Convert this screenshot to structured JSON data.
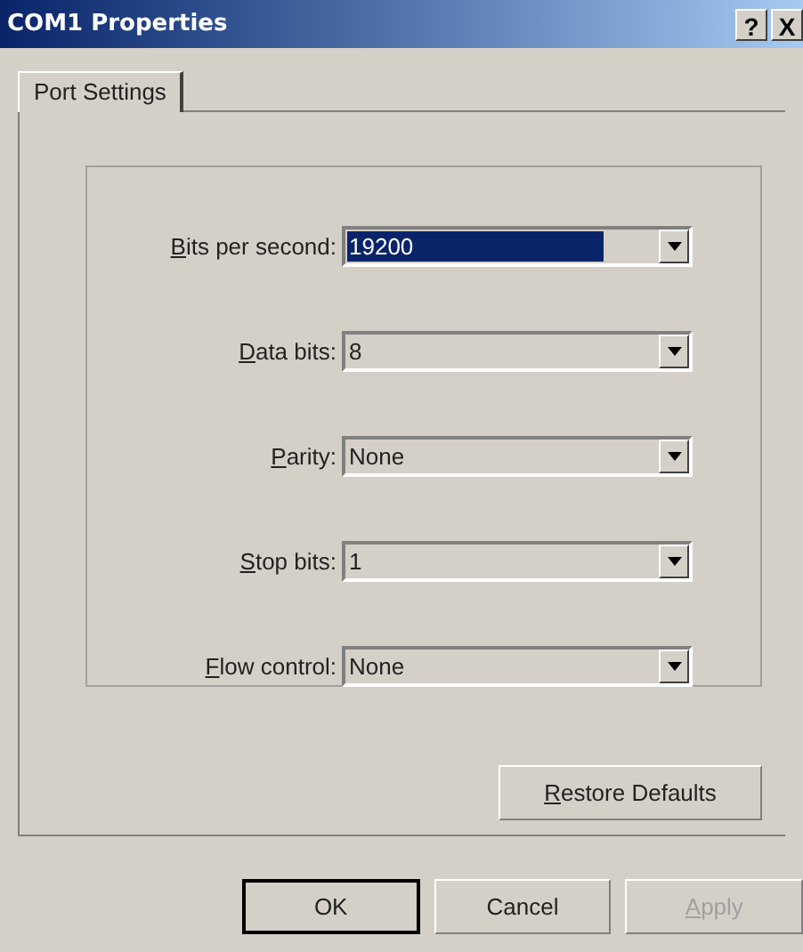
{
  "window": {
    "title": "COM1 Properties",
    "controls": [
      "?",
      "X"
    ]
  },
  "tabs": [
    {
      "label": "Port Settings",
      "selected": true
    }
  ],
  "fields": [
    {
      "label": "Bits per second:",
      "value": "19200",
      "focused": true,
      "underline_first": true
    },
    {
      "label": "Data bits:",
      "value": "8",
      "focused": false,
      "underline_first": true
    },
    {
      "label": "Parity:",
      "value": "None",
      "focused": false,
      "underline_first": true
    },
    {
      "label": "Stop bits:",
      "value": "1",
      "focused": false,
      "underline_first": true
    },
    {
      "label": "Flow control:",
      "value": "None",
      "focused": false,
      "underline_first": true
    }
  ],
  "restore_button": {
    "label": "Restore Defaults",
    "underline_first": true
  },
  "buttons": [
    {
      "label": "OK",
      "default": true,
      "disabled": false,
      "underline_first": false
    },
    {
      "label": "Cancel",
      "default": false,
      "disabled": false,
      "underline_first": false
    },
    {
      "label": "Apply",
      "default": false,
      "disabled": true,
      "underline_first": true
    }
  ]
}
